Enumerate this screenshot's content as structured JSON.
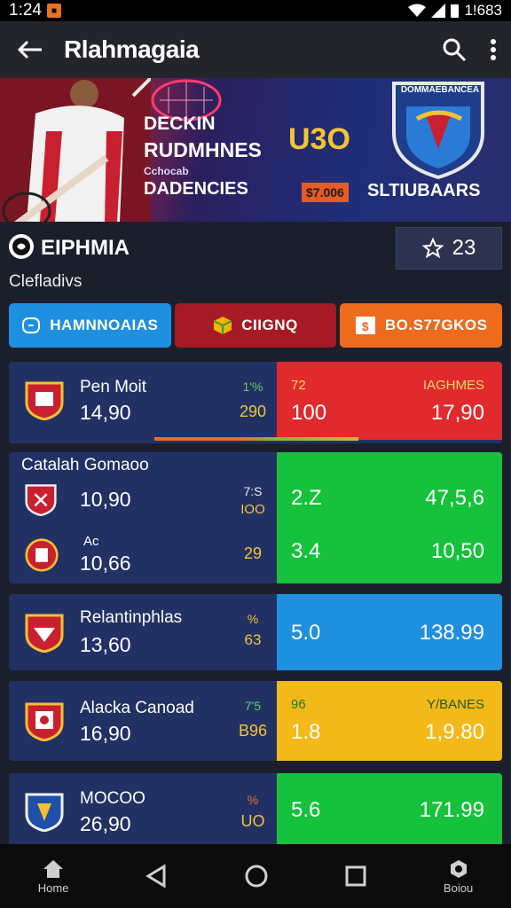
{
  "status": {
    "time": "1:24",
    "battery": "1!683"
  },
  "app": {
    "title": "Rlahmagaia"
  },
  "banner": {
    "line1": "DECKIN",
    "line2": "RUDMHNES",
    "line3": "DADENCIES",
    "small": "Cchocab",
    "promo": "U3O",
    "tag": "$7.006",
    "tag_text": "SLTIUBAARS",
    "crest_text": "DOMMAEBANCEA"
  },
  "section": {
    "name": "EIPHMIA",
    "favorite_count": "23",
    "subtitle": "Clefladivs"
  },
  "tabs": [
    {
      "label": "HAMNNOAIAS",
      "color": "#1f8fe0"
    },
    {
      "label": "CIIGNQ",
      "color": "#a51a25"
    },
    {
      "label": "BO.S77GKOS",
      "color": "#ee6a1c"
    }
  ],
  "matches": [
    {
      "team": "Pen Moit",
      "value": "14,90",
      "mini": "1'%",
      "num": "290",
      "odd_a": "100",
      "odd_b": "17,90",
      "odd_label": "IAGHMES",
      "odd_a_label": "72",
      "color": "#e02a2e"
    },
    {
      "team": "Catalah Gomaoo",
      "value": "10,90",
      "mini": "7:S",
      "num": "IOO",
      "odd_a": "2.Z",
      "odd_b": "47,5,6",
      "color": "#16c13c"
    },
    {
      "team": "Ac",
      "value": "10,66",
      "mini": "",
      "num": "29",
      "odd_a": "3.4",
      "odd_b": "10,50",
      "color": "#16c13c"
    },
    {
      "team": "Relantinphlas",
      "value": "13,60",
      "mini": "%",
      "num": "63",
      "odd_a": "5.0",
      "odd_b": "138.99",
      "color": "#1f8fe0"
    },
    {
      "team": "Alacka Canoad",
      "value": "16,90",
      "mini": "7'5",
      "num": "B96",
      "odd_a": "1.8",
      "odd_b": "1,9.80",
      "odd_label": "Y/BANES",
      "odd_a_label": "96",
      "color": "#f3b919"
    },
    {
      "team": "MOCOO",
      "value": "26,90",
      "mini": "%",
      "num": "UO",
      "odd_a": "5.6",
      "odd_b": "171.99",
      "color": "#16c13c"
    }
  ],
  "nav": {
    "home": "Home",
    "bonus": "Boiou"
  }
}
